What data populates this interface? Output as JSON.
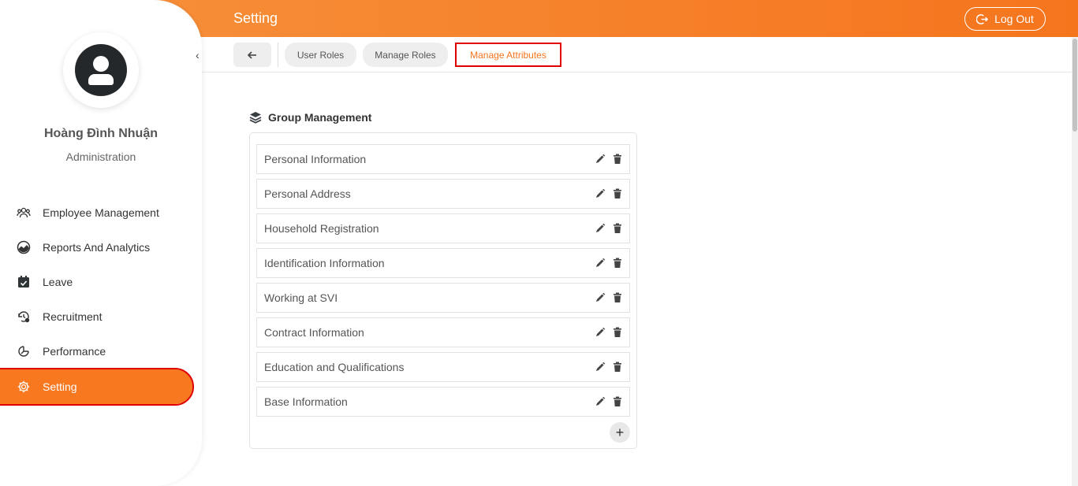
{
  "header": {
    "title": "Setting",
    "logout_label": "Log Out",
    "accent_color": "#f6802a"
  },
  "sidebar": {
    "user_name": "Hoàng Đình Nhuận",
    "user_role": "Administration",
    "items": [
      {
        "label": "Employee Management",
        "icon": "people-icon"
      },
      {
        "label": "Reports And Analytics",
        "icon": "chart-icon"
      },
      {
        "label": "Leave",
        "icon": "calendar-check-icon"
      },
      {
        "label": "Recruitment",
        "icon": "recruitment-icon"
      },
      {
        "label": "Performance",
        "icon": "performance-icon"
      },
      {
        "label": "Setting",
        "icon": "gear-icon",
        "active": true
      }
    ]
  },
  "tabs": [
    {
      "label": "User Roles"
    },
    {
      "label": "Manage Roles"
    },
    {
      "label": "Manage Attributes",
      "active": true
    }
  ],
  "group_management": {
    "title": "Group Management",
    "groups": [
      "Personal Information",
      "Personal Address",
      "Household Registration",
      "Identification Information",
      "Working at SVI",
      "Contract Information",
      "Education and Qualifications",
      "Base Information"
    ],
    "add_label": "+"
  }
}
